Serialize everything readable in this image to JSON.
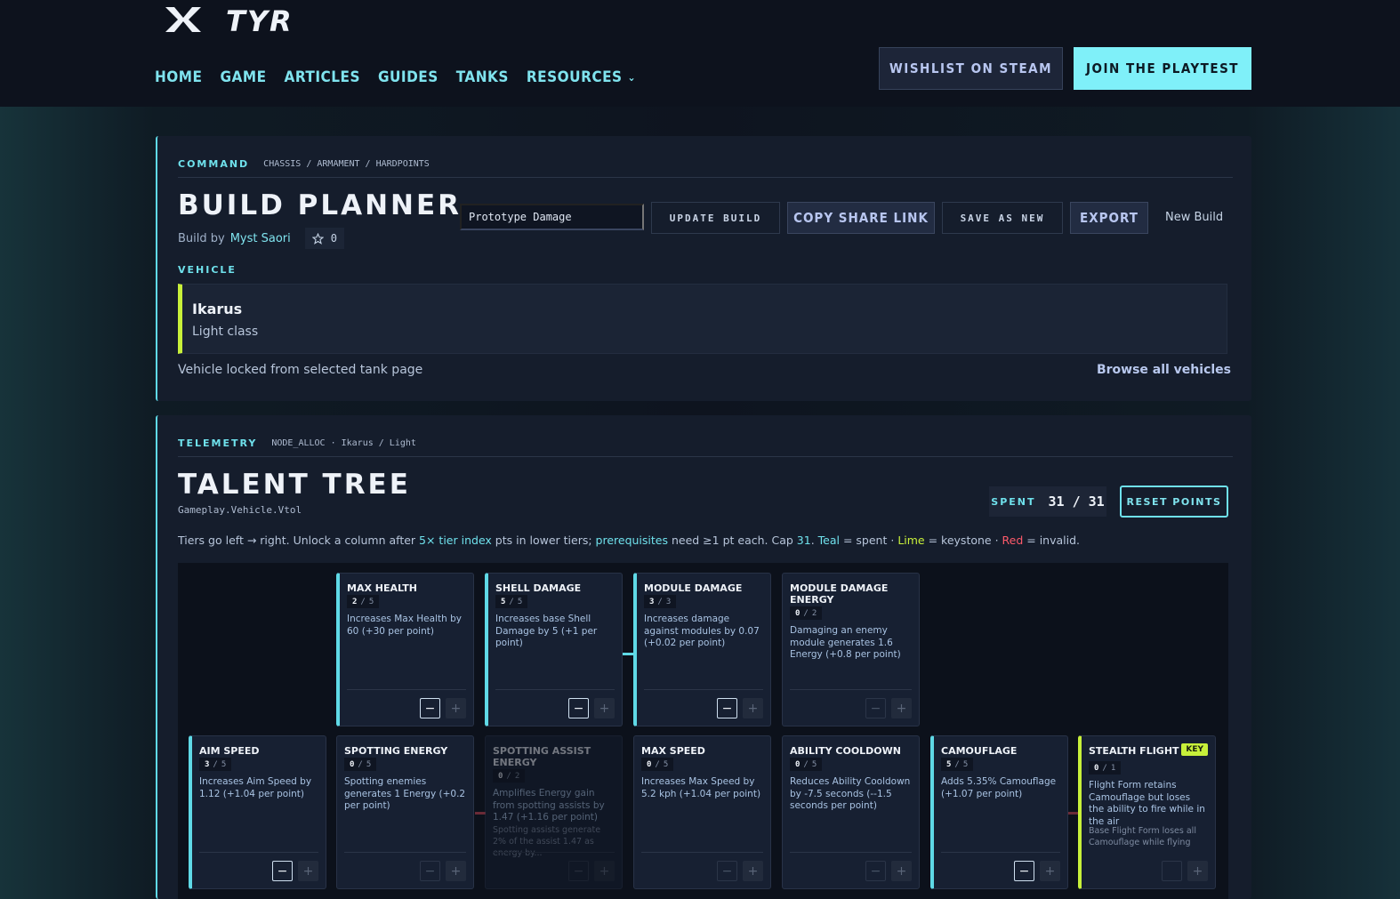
{
  "header": {
    "logo_text": "TYR",
    "nav": [
      {
        "label": "HOME"
      },
      {
        "label": "GAME"
      },
      {
        "label": "ARTICLES"
      },
      {
        "label": "GUIDES"
      },
      {
        "label": "TANKS"
      },
      {
        "label": "RESOURCES"
      }
    ],
    "wishlist_label": "WISHLIST ON STEAM",
    "playtest_label": "JOIN THE PLAYTEST"
  },
  "build_panel": {
    "eyebrow": "COMMAND",
    "crumb": "CHASSIS / ARMAMENT / HARDPOINTS",
    "title": "BUILD PLANNER",
    "byline_prefix": "Build by",
    "author": "Myst Saori",
    "stars": "0",
    "build_name_value": "Prototype Damage",
    "update_label": "UPDATE BUILD",
    "copy_label": "COPY SHARE LINK",
    "save_label": "SAVE AS NEW",
    "export_label": "EXPORT",
    "new_build_label": "New Build",
    "vehicle_label": "VEHICLE",
    "vehicle_name": "Ikarus",
    "vehicle_class": "Light class",
    "locked_text": "Vehicle locked from selected tank page",
    "browse_label": "Browse all vehicles"
  },
  "talent_panel": {
    "eyebrow": "TELEMETRY",
    "crumb": "NODE_ALLOC · Ikarus / Light",
    "title": "TALENT TREE",
    "subtitle": "Gameplay.Vehicle.Vtol",
    "spent_label": "SPENT",
    "spent_value": "31 / 31",
    "reset_label": "RESET POINTS",
    "legend": {
      "p1": "Tiers go left → right. Unlock a column after ",
      "tier": "5× tier index",
      "p2": " pts in lower tiers; ",
      "prereq": "prerequisites",
      "p3": " need ≥1 pt each. Cap ",
      "cap": "31",
      "p4": ". ",
      "teal": "Teal",
      "p5": " = spent · ",
      "lime": "Lime",
      "p6": " = keystone · ",
      "red": "Red",
      "p7": " = invalid."
    },
    "nodes": [
      {
        "title": "MAX HEALTH",
        "points": "2",
        "max": "5",
        "desc": "Increases Max Health by 60 (+30 per point)"
      },
      {
        "title": "SHELL DAMAGE",
        "points": "5",
        "max": "5",
        "desc": "Increases base Shell Damage by 5 (+1 per point)"
      },
      {
        "title": "MODULE DAMAGE",
        "points": "3",
        "max": "3",
        "desc": "Increases damage against modules by 0.07 (+0.02 per point)"
      },
      {
        "title": "MODULE DAMAGE ENERGY",
        "points": "0",
        "max": "2",
        "desc": "Damaging an enemy module generates 1.6 Energy (+0.8 per point)"
      },
      {
        "title": "AIM SPEED",
        "points": "3",
        "max": "5",
        "desc": "Increases Aim Speed by 1.12 (+1.04 per point)"
      },
      {
        "title": "SPOTTING ENERGY",
        "points": "0",
        "max": "5",
        "desc": "Spotting enemies generates 1 Energy (+0.2 per point)"
      },
      {
        "title": "SPOTTING ASSIST ENERGY",
        "points": "0",
        "max": "2",
        "desc": "Amplifies Energy gain from spotting assists by 1.47 (+1.16 per point)",
        "note": "Spotting assists generate 2% of the assist 1.47 as energy by..."
      },
      {
        "title": "MAX SPEED",
        "points": "0",
        "max": "5",
        "desc": "Increases Max Speed by 5.2 kph (+1.04 per point)"
      },
      {
        "title": "ABILITY COOLDOWN",
        "points": "0",
        "max": "5",
        "desc": "Reduces Ability Cooldown by -7.5 seconds (--1.5 seconds per point)"
      },
      {
        "title": "CAMOUFLAGE",
        "points": "5",
        "max": "5",
        "desc": "Adds 5.35% Camouflage (+1.07 per point)"
      },
      {
        "title": "STEALTH FLIGHT",
        "points": "0",
        "max": "1",
        "desc": "Flight Form retains Camouflage but loses the ability to fire while in the air",
        "note": "Base Flight Form loses all Camouflage while flying",
        "badge": "KEY"
      }
    ],
    "minus_glyph": "−",
    "plus_glyph": "+",
    "colors": {
      "spent": "#5fd9e6",
      "keystone": "#c8f03a",
      "invalid": "#ff5a6a"
    }
  }
}
